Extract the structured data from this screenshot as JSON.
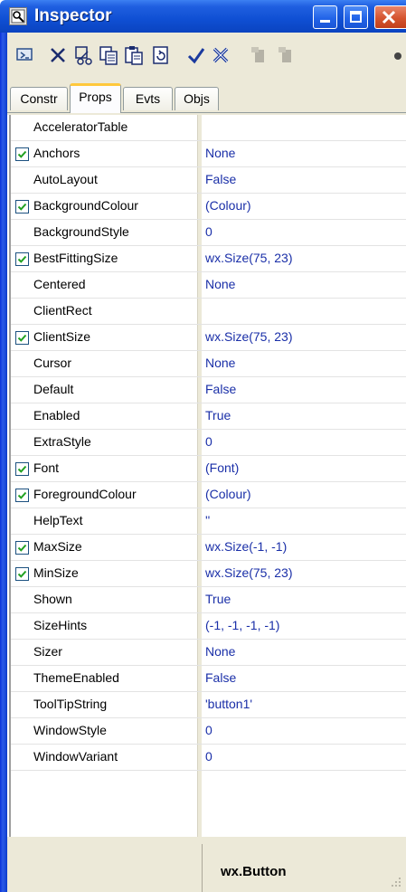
{
  "window": {
    "title": "Inspector"
  },
  "toolbar": {
    "icons": [
      "open-icon",
      "delete-icon",
      "cut-icon",
      "copy-icon",
      "paste-icon",
      "refresh-icon",
      "post-icon",
      "cancel-icon",
      "disabled-tool-icon",
      "disabled-tool-icon"
    ]
  },
  "tabs": [
    {
      "label": "Constr"
    },
    {
      "label": "Props"
    },
    {
      "label": "Evts"
    },
    {
      "label": "Objs"
    }
  ],
  "properties": [
    {
      "name": "AcceleratorTable",
      "value": "",
      "checkbox": false
    },
    {
      "name": "Anchors",
      "value": "None",
      "checkbox": true
    },
    {
      "name": "AutoLayout",
      "value": "False",
      "checkbox": false
    },
    {
      "name": "BackgroundColour",
      "value": "(Colour)",
      "checkbox": true
    },
    {
      "name": "BackgroundStyle",
      "value": "0",
      "checkbox": false
    },
    {
      "name": "BestFittingSize",
      "value": "wx.Size(75, 23)",
      "checkbox": true
    },
    {
      "name": "Centered",
      "value": "None",
      "checkbox": false
    },
    {
      "name": "ClientRect",
      "value": "",
      "checkbox": false
    },
    {
      "name": "ClientSize",
      "value": "wx.Size(75, 23)",
      "checkbox": true
    },
    {
      "name": "Cursor",
      "value": "None",
      "checkbox": false
    },
    {
      "name": "Default",
      "value": "False",
      "checkbox": false
    },
    {
      "name": "Enabled",
      "value": "True",
      "checkbox": false
    },
    {
      "name": "ExtraStyle",
      "value": "0",
      "checkbox": false
    },
    {
      "name": "Font",
      "value": "(Font)",
      "checkbox": true
    },
    {
      "name": "ForegroundColour",
      "value": "(Colour)",
      "checkbox": true
    },
    {
      "name": "HelpText",
      "value": "''",
      "checkbox": false
    },
    {
      "name": "MaxSize",
      "value": "wx.Size(-1, -1)",
      "checkbox": true
    },
    {
      "name": "MinSize",
      "value": "wx.Size(75, 23)",
      "checkbox": true
    },
    {
      "name": "Shown",
      "value": "True",
      "checkbox": false
    },
    {
      "name": "SizeHints",
      "value": "(-1, -1, -1, -1)",
      "checkbox": false
    },
    {
      "name": "Sizer",
      "value": "None",
      "checkbox": false
    },
    {
      "name": "ThemeEnabled",
      "value": "False",
      "checkbox": false
    },
    {
      "name": "ToolTipString",
      "value": "'button1'",
      "checkbox": false
    },
    {
      "name": "WindowStyle",
      "value": "0",
      "checkbox": false
    },
    {
      "name": "WindowVariant",
      "value": "0",
      "checkbox": false
    }
  ],
  "statusbar": {
    "text": "wx.Button"
  },
  "colors": {
    "titlebar": "#0a43c0",
    "value_text": "#1a2fa8",
    "active_tab_accent": "#ffc83c",
    "face": "#ece9d8"
  }
}
